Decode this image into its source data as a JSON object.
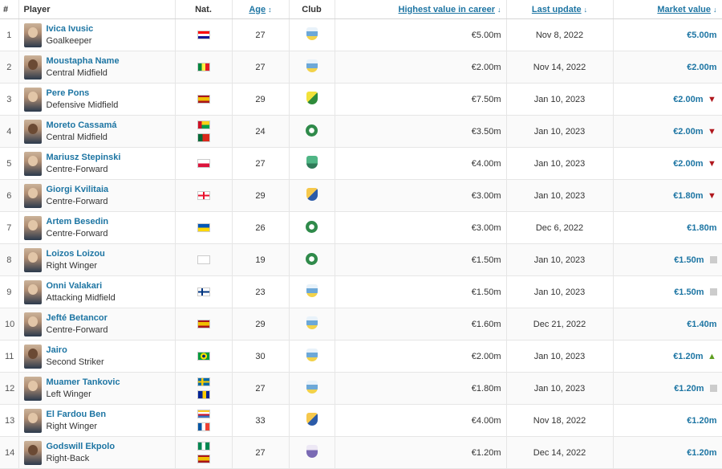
{
  "headers": {
    "num": "#",
    "player": "Player",
    "nat": "Nat.",
    "age": "Age",
    "club": "Club",
    "highest": "Highest value in career",
    "last_update": "Last update",
    "market_value": "Market value"
  },
  "players": [
    {
      "num": "1",
      "name": "Ivica Ivusic",
      "position": "Goalkeeper",
      "flags": [
        "croatia"
      ],
      "age": "27",
      "club": "club-crest-pale-blue",
      "highest": "€5.00m",
      "updated": "Nov 8, 2022",
      "value": "€5.00m",
      "trend": "none"
    },
    {
      "num": "2",
      "name": "Moustapha Name",
      "position": "Central Midfield",
      "flags": [
        "senegal"
      ],
      "age": "27",
      "club": "club-crest-pale-blue",
      "highest": "€2.00m",
      "updated": "Nov 14, 2022",
      "value": "€2.00m",
      "trend": "none"
    },
    {
      "num": "3",
      "name": "Pere Pons",
      "position": "Defensive Midfield",
      "flags": [
        "spain"
      ],
      "age": "29",
      "club": "club-crest-yellow-green",
      "highest": "€7.50m",
      "updated": "Jan 10, 2023",
      "value": "€2.00m",
      "trend": "down"
    },
    {
      "num": "4",
      "name": "Moreto Cassamá",
      "position": "Central Midfield",
      "flags": [
        "guinea-bissau",
        "portugal"
      ],
      "age": "24",
      "club": "club-crest-green-circle",
      "highest": "€3.50m",
      "updated": "Jan 10, 2023",
      "value": "€2.00m",
      "trend": "down"
    },
    {
      "num": "5",
      "name": "Mariusz Stepinski",
      "position": "Centre-Forward",
      "flags": [
        "poland"
      ],
      "age": "27",
      "club": "club-crest-green",
      "highest": "€4.00m",
      "updated": "Jan 10, 2023",
      "value": "€2.00m",
      "trend": "down"
    },
    {
      "num": "6",
      "name": "Giorgi Kvilitaia",
      "position": "Centre-Forward",
      "flags": [
        "georgia"
      ],
      "age": "29",
      "club": "club-crest-blue-yellow",
      "highest": "€3.00m",
      "updated": "Jan 10, 2023",
      "value": "€1.80m",
      "trend": "down"
    },
    {
      "num": "7",
      "name": "Artem Besedin",
      "position": "Centre-Forward",
      "flags": [
        "ukraine"
      ],
      "age": "26",
      "club": "club-crest-green-circle",
      "highest": "€3.00m",
      "updated": "Dec 6, 2022",
      "value": "€1.80m",
      "trend": "none"
    },
    {
      "num": "8",
      "name": "Loizos Loizou",
      "position": "Right Winger",
      "flags": [
        "cyprus"
      ],
      "age": "19",
      "club": "club-crest-green-circle",
      "highest": "€1.50m",
      "updated": "Jan 10, 2023",
      "value": "€1.50m",
      "trend": "same"
    },
    {
      "num": "9",
      "name": "Onni Valakari",
      "position": "Attacking Midfield",
      "flags": [
        "finland"
      ],
      "age": "23",
      "club": "club-crest-pale-blue",
      "highest": "€1.50m",
      "updated": "Jan 10, 2023",
      "value": "€1.50m",
      "trend": "same"
    },
    {
      "num": "10",
      "name": "Jefté Betancor",
      "position": "Centre-Forward",
      "flags": [
        "spain"
      ],
      "age": "29",
      "club": "club-crest-pale-blue",
      "highest": "€1.60m",
      "updated": "Dec 21, 2022",
      "value": "€1.40m",
      "trend": "none"
    },
    {
      "num": "11",
      "name": "Jairo",
      "position": "Second Striker",
      "flags": [
        "brazil"
      ],
      "age": "30",
      "club": "club-crest-pale-blue",
      "highest": "€2.00m",
      "updated": "Jan 10, 2023",
      "value": "€1.20m",
      "trend": "up"
    },
    {
      "num": "12",
      "name": "Muamer Tankovic",
      "position": "Left Winger",
      "flags": [
        "sweden",
        "bosnia"
      ],
      "age": "27",
      "club": "club-crest-pale-blue",
      "highest": "€1.80m",
      "updated": "Jan 10, 2023",
      "value": "€1.20m",
      "trend": "same"
    },
    {
      "num": "13",
      "name": "El Fardou Ben",
      "position": "Right Winger",
      "flags": [
        "comoros",
        "france"
      ],
      "age": "33",
      "club": "club-crest-blue-yellow",
      "highest": "€4.00m",
      "updated": "Nov 18, 2022",
      "value": "€1.20m",
      "trend": "none"
    },
    {
      "num": "14",
      "name": "Godswill Ekpolo",
      "position": "Right-Back",
      "flags": [
        "nigeria",
        "spain"
      ],
      "age": "27",
      "club": "club-crest-purple",
      "highest": "€1.20m",
      "updated": "Dec 14, 2022",
      "value": "€1.20m",
      "trend": "none"
    }
  ],
  "colors": {
    "link": "#1d75a3",
    "down": "#b0171d",
    "up": "#5f9e21",
    "neutral": "#cccccc"
  }
}
